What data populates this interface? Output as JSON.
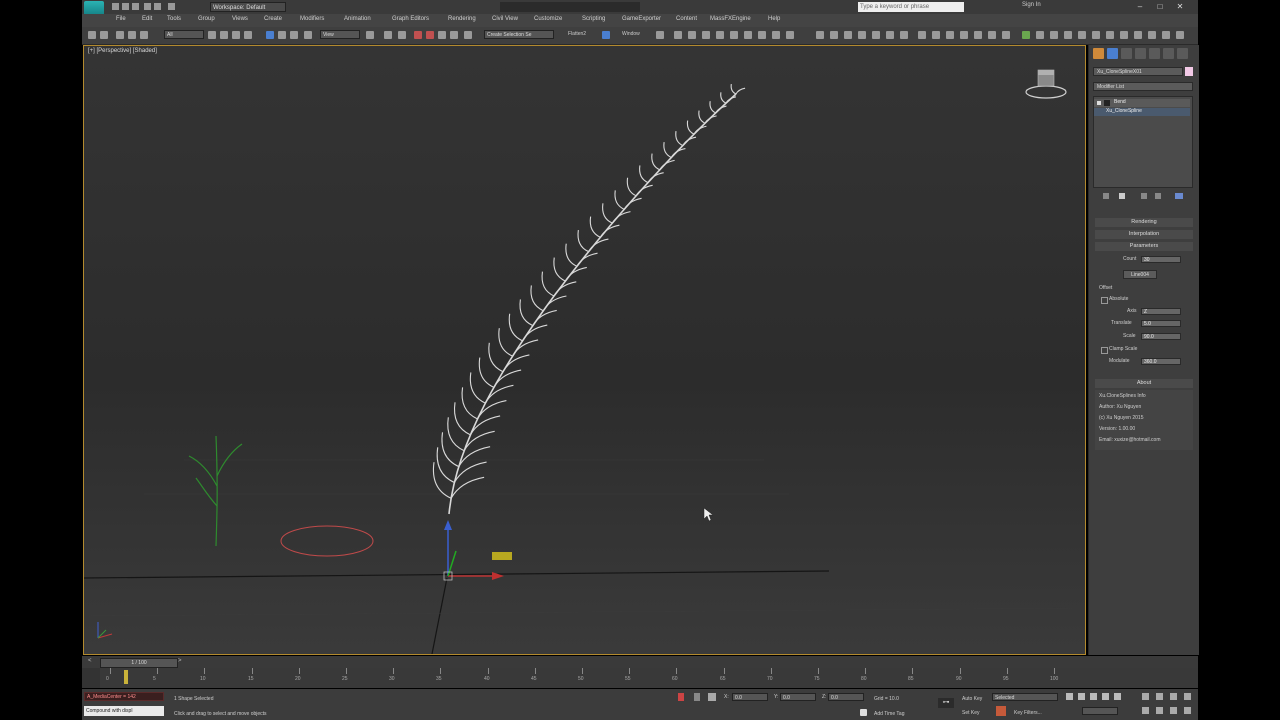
{
  "title": {
    "workspace": "Workspace: Default",
    "center_title": "",
    "search_placeholder": "Type a keyword or phrase",
    "sign_in": "Sign In"
  },
  "menu": [
    "File",
    "Edit",
    "Tools",
    "Group",
    "Views",
    "Create",
    "Modifiers",
    "Animation",
    "Graph Editors",
    "Rendering",
    "Civil View",
    "Customize",
    "Scripting",
    "GameExporter",
    "Content",
    "MassFXEngine",
    "Help"
  ],
  "toolbar": {
    "selection_filter": "All",
    "ref_coord": "View",
    "named_sel": "Create Selection Se",
    "text1": "Flatten2",
    "text2": "Window"
  },
  "viewport": {
    "label": "[+] [Perspective] [Shaded]"
  },
  "panel": {
    "object_name": "Xu_CloneSplineX01",
    "modifier_list": "Modifier List",
    "stack": [
      "Bend",
      "Xu_CloneSpline"
    ],
    "rollouts": {
      "rendering": "Rendering",
      "interpolation": "Interpolation",
      "parameters": "Parameters"
    },
    "count_label": "Count",
    "count_value": "30",
    "line_button": "Line004",
    "offset_label": "Offset",
    "absolute_label": "Absolute",
    "axis_label": "Axis",
    "axis_value": "Z",
    "translate_label": "Translate",
    "translate_value": "5.0",
    "scale_label": "Scale",
    "scale_value": "90.0",
    "clamp_label": "Clamp Scale",
    "modulate_label": "Modulate",
    "modulate_value": "360.0",
    "about_title": "About",
    "about_lines": [
      "Xu.CloneSplines Info",
      "Author: Xu Nguyen",
      "(c) Xu Nguyen 2015",
      "Version: 1.00.00",
      "Email: xuxize@hotmail.com"
    ]
  },
  "timeline": {
    "frame": "1 / 100",
    "ticks": [
      "0",
      "5",
      "10",
      "15",
      "20",
      "25",
      "30",
      "35",
      "40",
      "45",
      "50",
      "55",
      "60",
      "65",
      "70",
      "75",
      "80",
      "85",
      "90",
      "95",
      "100"
    ]
  },
  "status": {
    "maxscript_in": "A_MediaCenter = 142",
    "maxscript_out": "Compound with dispI",
    "selection": "1 Shape Selected",
    "prompt": "Click and drag to select and move objects",
    "x_label": "X:",
    "x": "0.0",
    "y_label": "Y:",
    "y": "0.0",
    "z_label": "Z:",
    "z": "0.0",
    "grid": "Grid = 10.0",
    "add_time_tag": "Add Time Tag",
    "auto_key": "Auto Key",
    "selected": "Selected",
    "set_key": "Set Key",
    "key_filters": "Key Filters..."
  },
  "colors": {
    "viewport_border": "#b38a2e",
    "spline": "#d9d9d9",
    "helper": "#2e8b2e",
    "circle": "#c04a4a"
  }
}
